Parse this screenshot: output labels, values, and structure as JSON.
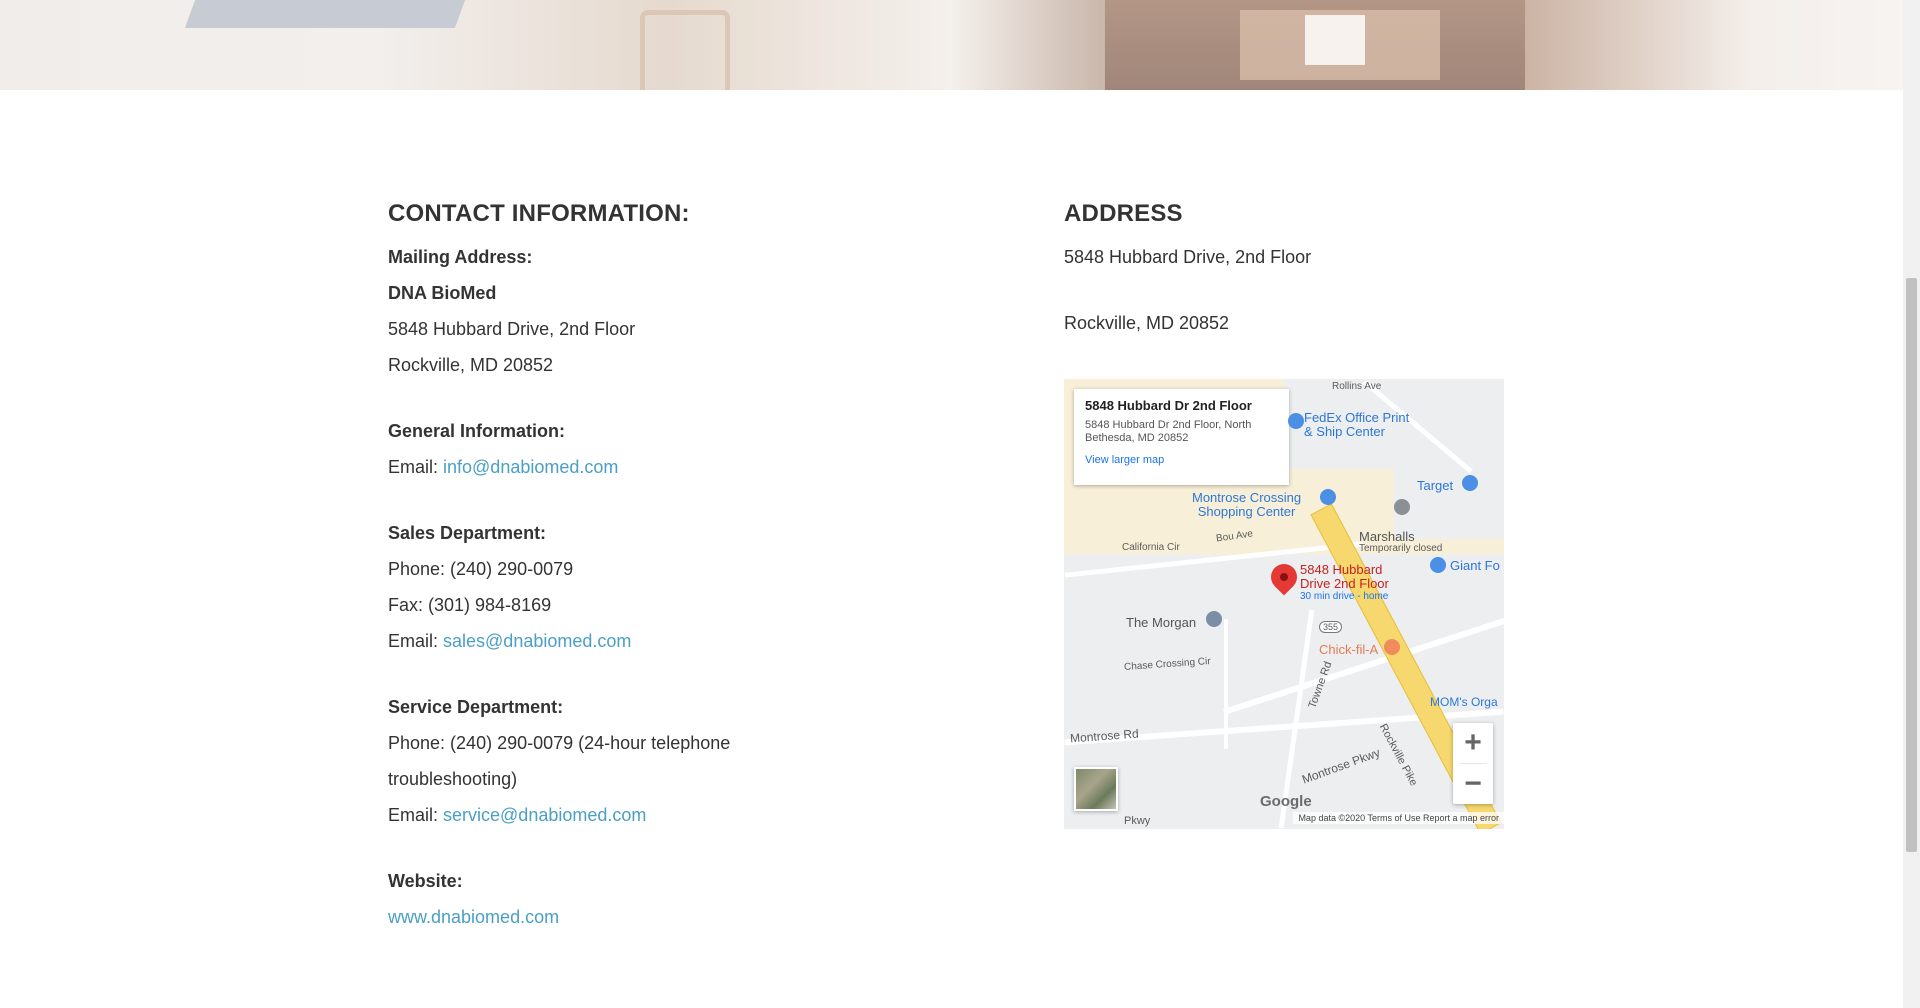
{
  "contact": {
    "heading": "CONTACT INFORMATION:",
    "mailing_label": "Mailing Address:",
    "company": "DNA BioMed",
    "street": "5848 Hubbard Drive, 2nd Floor",
    "city": "Rockville, MD 20852",
    "general_label": "General Information:",
    "general_email_prefix": "Email: ",
    "general_email": "info@dnabiomed.com",
    "sales_label": "Sales Department:",
    "sales_phone": "Phone: (240) 290-0079",
    "sales_fax": "Fax: (301) 984-8169",
    "sales_email_prefix": "Email: ",
    "sales_email": "sales@dnabiomed.com",
    "service_label": "Service Department:",
    "service_phone_line1": "Phone: (240) 290-0079 (24-hour telephone",
    "service_phone_line2": "troubleshooting)",
    "service_email_prefix": "Email: ",
    "service_email": "service@dnabiomed.com",
    "website_label": "Website:",
    "website": "www.dnabiomed.com"
  },
  "address": {
    "heading": "ADDRESS",
    "line1": "5848 Hubbard Drive, 2nd Floor",
    "line2": "Rockville, MD 20852"
  },
  "map": {
    "info_title": "5848 Hubbard Dr 2nd Floor",
    "info_address": "5848 Hubbard Dr 2nd Floor, North Bethesda, MD 20852",
    "info_link": "View larger map",
    "pin_label_1": "5848 Hubbard",
    "pin_label_2": "Drive 2nd Floor",
    "pin_sub": "30 min drive - home",
    "labels": {
      "rollins": "Rollins Ave",
      "fedex_1": "FedEx Office Print",
      "fedex_2": "& Ship Center",
      "target": "Target",
      "montrose_crossing_1": "Montrose Crossing",
      "montrose_crossing_2": "Shopping Center",
      "marshalls": "Marshalls",
      "marshalls_sub": "Temporarily closed",
      "bou": "Bou Ave",
      "california": "California Cir",
      "giant": "Giant Fo",
      "morgan": "The Morgan",
      "route": "355",
      "chickfila": "Chick-fil-A",
      "chase": "Chase Crossing Cir",
      "towne": "Towne Rd",
      "moms": "MOM's Orga",
      "montrose_rd": "Montrose Rd",
      "montrose_pkwy": "Montrose Pkwy",
      "rockville_pike": "Rockville Pike",
      "pkwy": "Pkwy"
    },
    "zoom_in": "+",
    "zoom_out": "−",
    "google": "Google",
    "footer": "Map data ©2020   Terms of Use   Report a map error"
  }
}
